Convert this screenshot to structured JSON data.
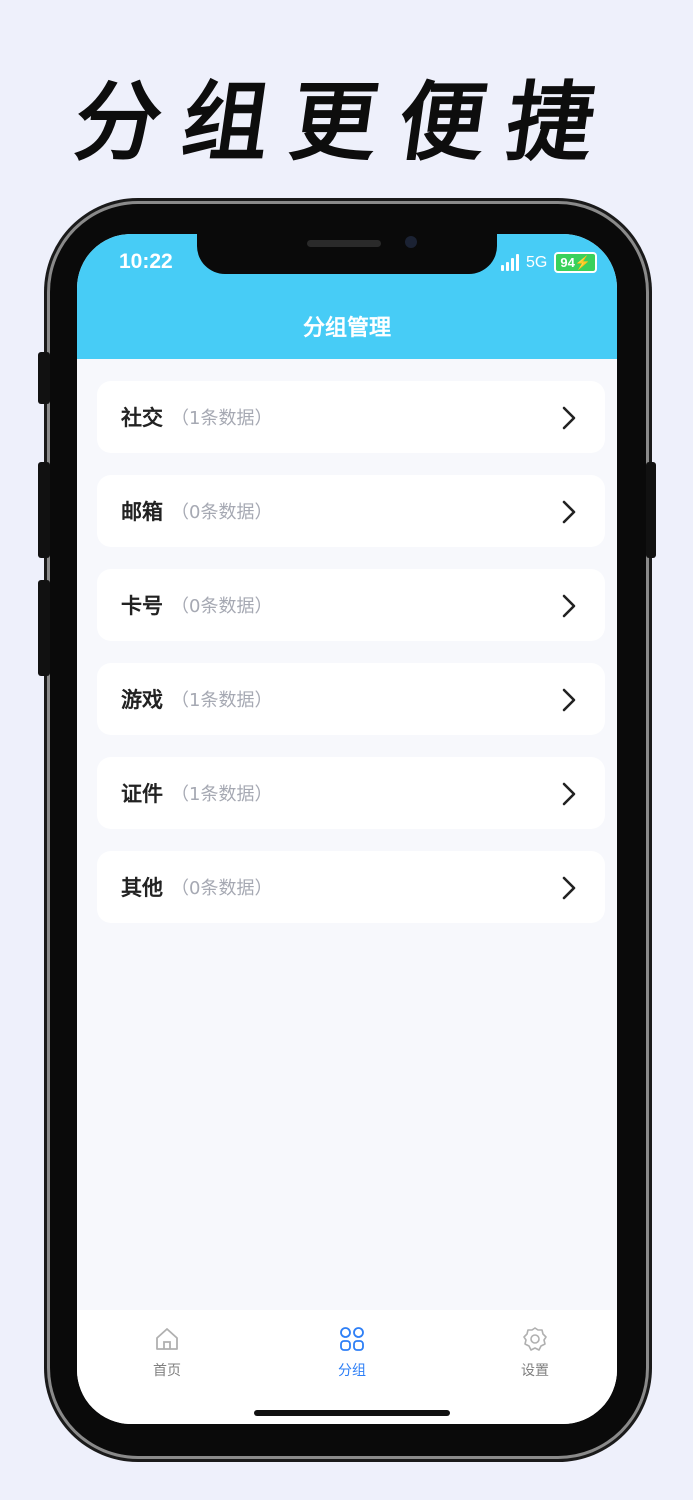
{
  "promo": {
    "title": "分组更便捷"
  },
  "status_bar": {
    "time": "10:22",
    "network": "5G",
    "battery": "94"
  },
  "header": {
    "title": "分组管理"
  },
  "groups": [
    {
      "name": "社交",
      "count": "（1条数据）"
    },
    {
      "name": "邮箱",
      "count": "（0条数据）"
    },
    {
      "name": "卡号",
      "count": "（0条数据）"
    },
    {
      "name": "游戏",
      "count": "（1条数据）"
    },
    {
      "name": "证件",
      "count": "（1条数据）"
    },
    {
      "name": "其他",
      "count": "（0条数据）"
    }
  ],
  "tabs": [
    {
      "label": "首页",
      "icon": "home-icon",
      "active": false
    },
    {
      "label": "分组",
      "icon": "grid-icon",
      "active": true
    },
    {
      "label": "设置",
      "icon": "gear-icon",
      "active": false
    }
  ],
  "colors": {
    "header": "#47ccf6",
    "active_tab": "#2e7ff6",
    "background": "#eef0fb"
  }
}
